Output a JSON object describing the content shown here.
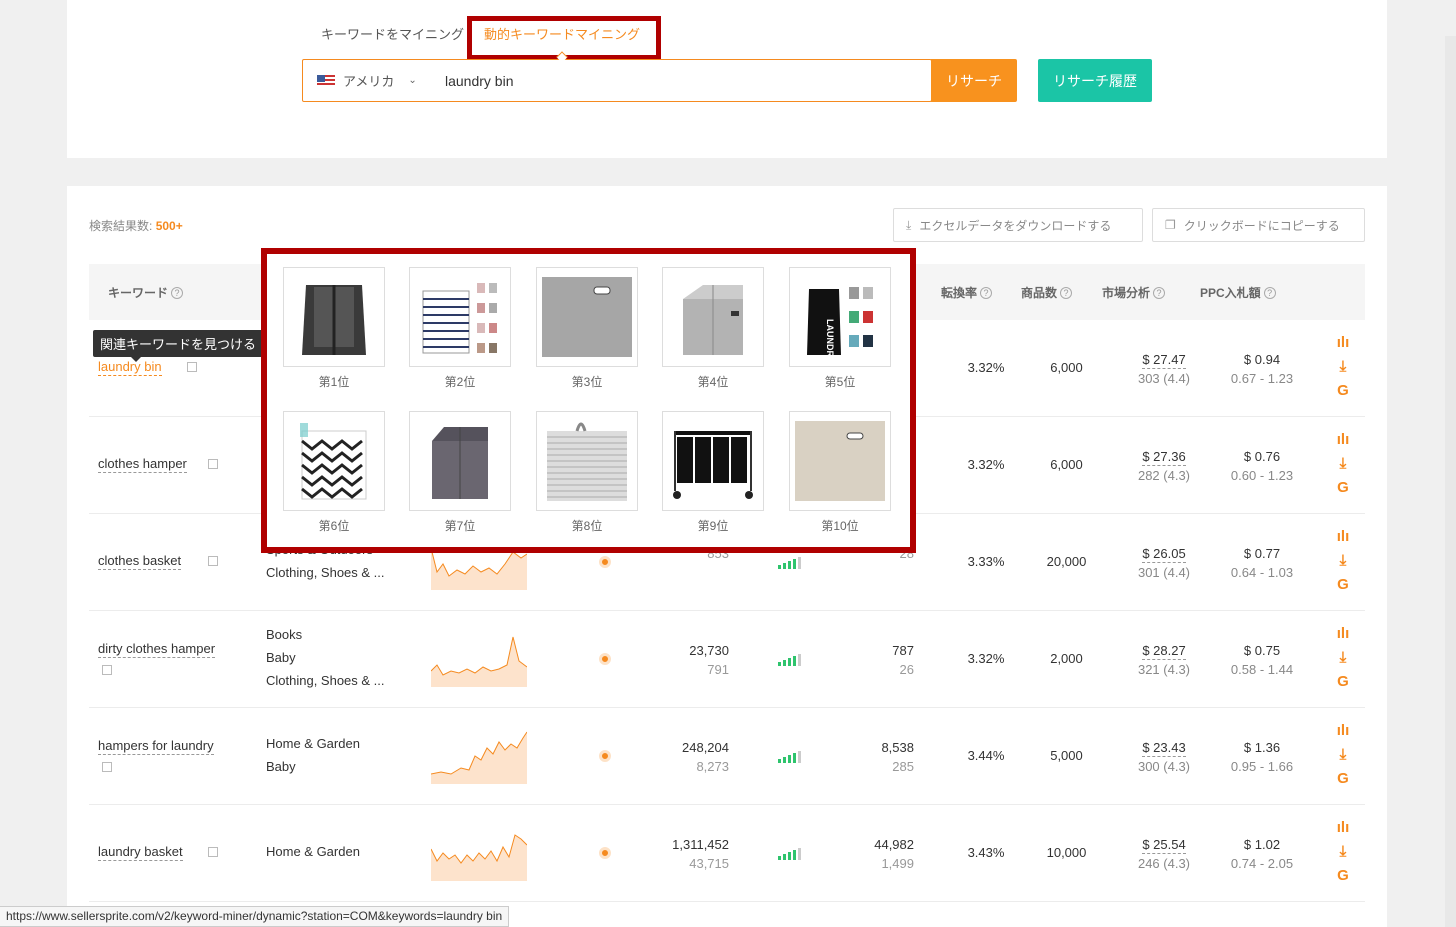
{
  "tabs": [
    "キーワードをマイニング",
    "動的キーワードマイニング"
  ],
  "search": {
    "market": "アメリカ",
    "query": "laundry bin",
    "search_label": "リサーチ",
    "history_label": "リサーチ履歴"
  },
  "results": {
    "label": "検索結果数:",
    "count": "500+",
    "download_label": "エクセルデータをダウンロードする",
    "copy_label": "クリックボードにコピーする"
  },
  "headers": {
    "keyword": "キーワード",
    "conversion": "転換率",
    "products": "商品数",
    "market": "市場分析",
    "ppc": "PPC入札額"
  },
  "tooltip": "関連キーワードを見つける",
  "popup": [
    "第1位",
    "第2位",
    "第3位",
    "第4位",
    "第5位",
    "第6位",
    "第7位",
    "第8位",
    "第9位",
    "第10位"
  ],
  "rows": [
    {
      "kw": "laundry bin",
      "cats": [],
      "s1": "",
      "s2": "",
      "r1": "",
      "r2": "",
      "conv": "3.32%",
      "prod": "6,000",
      "price": "$ 27.47",
      "rating": "303 (4.4)",
      "ppc": "$ 0.94",
      "ppc_range": "0.67 - 1.23"
    },
    {
      "kw": "clothes hamper",
      "cats": [],
      "s1": "",
      "s2": "",
      "r1": "",
      "r2": "",
      "conv": "3.32%",
      "prod": "6,000",
      "price": "$ 27.36",
      "rating": "282 (4.3)",
      "ppc": "$ 0.76",
      "ppc_range": "0.60 - 1.23"
    },
    {
      "kw": "clothes basket",
      "cats": [
        "Sports & Outdoors",
        "Clothing, Shoes & ..."
      ],
      "s1": "",
      "s2": "853",
      "r1": "",
      "r2": "28",
      "conv": "3.33%",
      "prod": "20,000",
      "price": "$ 26.05",
      "rating": "301 (4.4)",
      "ppc": "$ 0.77",
      "ppc_range": "0.64 - 1.03"
    },
    {
      "kw": "dirty clothes hamper",
      "cats": [
        "Books",
        "Baby",
        "Clothing, Shoes & ..."
      ],
      "s1": "23,730",
      "s2": "791",
      "r1": "787",
      "r2": "26",
      "conv": "3.32%",
      "prod": "2,000",
      "price": "$ 28.27",
      "rating": "321 (4.3)",
      "ppc": "$ 0.75",
      "ppc_range": "0.58 - 1.44"
    },
    {
      "kw": "hampers for laundry",
      "cats": [
        "Home & Garden",
        "Baby"
      ],
      "s1": "248,204",
      "s2": "8,273",
      "r1": "8,538",
      "r2": "285",
      "conv": "3.44%",
      "prod": "5,000",
      "price": "$ 23.43",
      "rating": "300 (4.3)",
      "ppc": "$ 1.36",
      "ppc_range": "0.95 - 1.66"
    },
    {
      "kw": "laundry basket",
      "cats": [
        "Home & Garden"
      ],
      "s1": "1,311,452",
      "s2": "43,715",
      "r1": "44,982",
      "r2": "1,499",
      "conv": "3.43%",
      "prod": "10,000",
      "price": "$ 25.54",
      "rating": "246 (4.3)",
      "ppc": "$ 1.02",
      "ppc_range": "0.74 - 2.05"
    }
  ],
  "status_url": "https://www.sellersprite.com/v2/keyword-miner/dynamic?station=COM&keywords=laundry bin"
}
